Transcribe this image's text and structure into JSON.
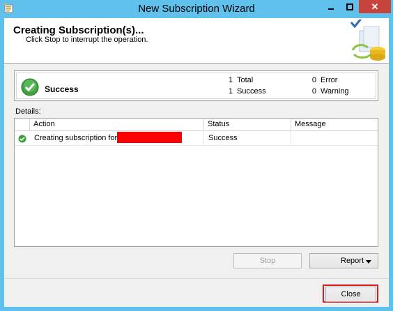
{
  "window": {
    "title": "New Subscription Wizard",
    "controls": {
      "minimize": "minimize",
      "maximize": "maximize",
      "close": "✕"
    }
  },
  "header": {
    "title": "Creating Subscription(s)...",
    "subtitle": "Click Stop to interrupt the operation."
  },
  "summary": {
    "status": "Success",
    "total_count": "1",
    "total_label": "Total",
    "success_count": "1",
    "success_label": "Success",
    "error_count": "0",
    "error_label": "Error",
    "warning_count": "0",
    "warning_label": "Warning"
  },
  "details": {
    "label": "Details:",
    "columns": [
      "Action",
      "Status",
      "Message"
    ],
    "rows": [
      {
        "action": "Creating subscription for",
        "status": "Success",
        "message": ""
      }
    ]
  },
  "buttons": {
    "stop": "Stop",
    "report": "Report",
    "close": "Close"
  },
  "colors": {
    "accent": "#5fc1ec",
    "close_button_red": "#c7443d",
    "highlight_red": "#e0181e",
    "success_green": "#3ea03e"
  },
  "icons": {
    "app": "wizard-app-icon",
    "success": "check-circle-icon",
    "header": "subscription-database-icon"
  }
}
